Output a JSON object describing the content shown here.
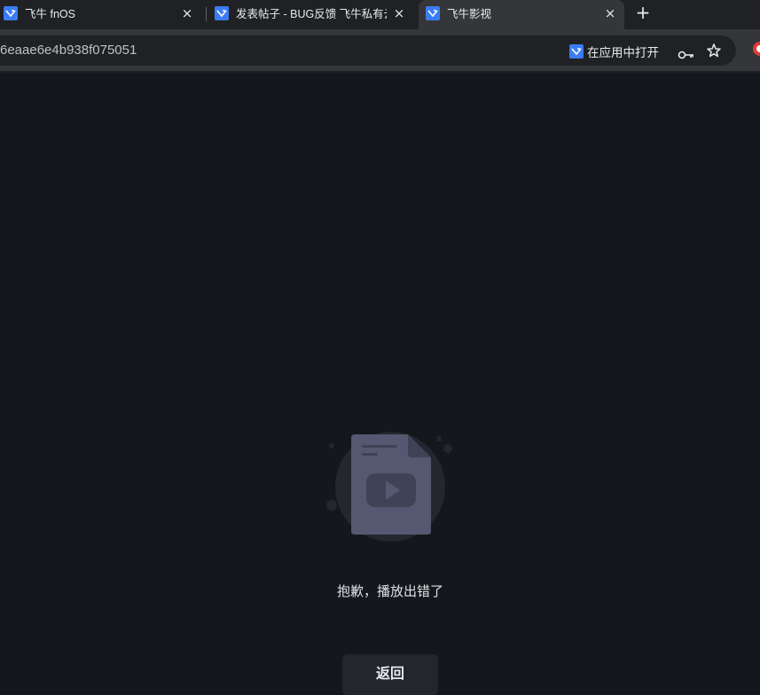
{
  "tabs": [
    {
      "title": "飞牛 fnOS",
      "active": false,
      "favicon": "fnos-favicon",
      "close": "×"
    },
    {
      "title": "发表帖子 - BUG反馈 飞牛私有云",
      "active": false,
      "favicon": "fnos-favicon",
      "close": "×"
    },
    {
      "title": "飞牛影视",
      "active": true,
      "favicon": "fnos-favicon",
      "close": "×"
    }
  ],
  "new_tab_label": "+",
  "address_bar": {
    "url": "6eaae6e4b938f075051",
    "open_in_app_label": "在应用中打开"
  },
  "page": {
    "error_message": "抱歉，播放出错了",
    "back_button_label": "返回"
  },
  "colors": {
    "brand": "#3b7cf5",
    "background": "#14171b",
    "button": "#23262c"
  }
}
